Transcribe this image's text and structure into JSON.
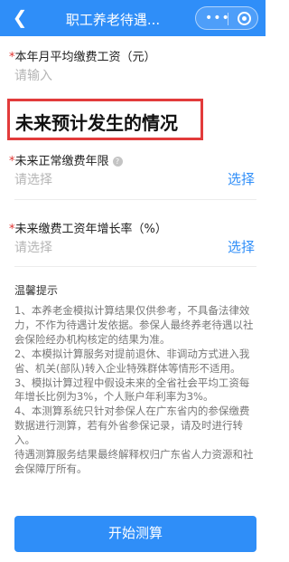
{
  "nav": {
    "back_icon": "chevron-left-icon",
    "title": "职工养老待遇...",
    "more_glyph": "•••",
    "close_icon": "target-icon"
  },
  "form": {
    "salary": {
      "required_mark": "*",
      "label": "本年月平均缴费工资（元）",
      "placeholder": "请输入"
    },
    "section_heading": "未来预计发生的情况",
    "years": {
      "required_mark": "*",
      "label": "未来正常缴费年限",
      "help_icon": "question-icon",
      "help_glyph": "?",
      "placeholder": "请选择",
      "action": "选择"
    },
    "growth": {
      "required_mark": "*",
      "label": "未来缴费工资年增长率（%）",
      "placeholder": "请选择",
      "action": "选择"
    }
  },
  "tips": {
    "title": "温馨提示",
    "items": [
      "1、本养老金模拟计算结果仅供参考，不具备法律效力，不作为待遇计发依据。参保人最终养老待遇以社会保险经办机构核定的结果为准。",
      "2、本模拟计算服务对提前退休、非调动方式进入我省、机关(部队)转入企业特殊群体等情形不适用。",
      "3、模拟计算过程中假设未来的全省社会平均工资每年增长比例为3%，个人账户年利率为3%。",
      "4、本测算系统只针对参保人在广东省内的参保缴费数据进行测算，若有外省参保记录，请及时进行转入。",
      "待遇测算服务结果最终解释权归广东省人力资源和社会保障厅所有。"
    ]
  },
  "actions": {
    "start": "开始测算"
  },
  "colors": {
    "primary": "#2f8ef8",
    "highlight_border": "#e23b3b",
    "required": "#e0322f"
  }
}
